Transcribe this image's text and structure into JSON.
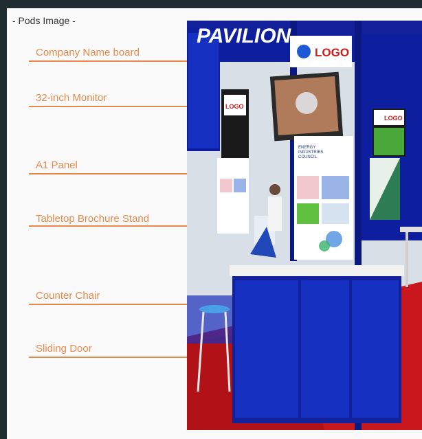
{
  "heading": "- Pods Image -",
  "labels": {
    "company_name_board": "Company Name board",
    "monitor": "32-inch Monitor",
    "a1_panel": "A1 Panel",
    "brochure_stand": "Tabletop Brochure Stand",
    "counter_chair": "Counter Chair",
    "sliding_door": "Sliding Door"
  },
  "photo": {
    "pavilion_sign": "PAVILION",
    "logo_text": "LOGO",
    "panel_text": "ENERGY INDUSTRIES COUNCIL",
    "left_logo": "LOGO",
    "right_logo": "LOGO"
  },
  "colors": {
    "accent_orange": "#e9894a",
    "booth_blue": "#0d1f9e",
    "floor_red": "#c8171d"
  }
}
